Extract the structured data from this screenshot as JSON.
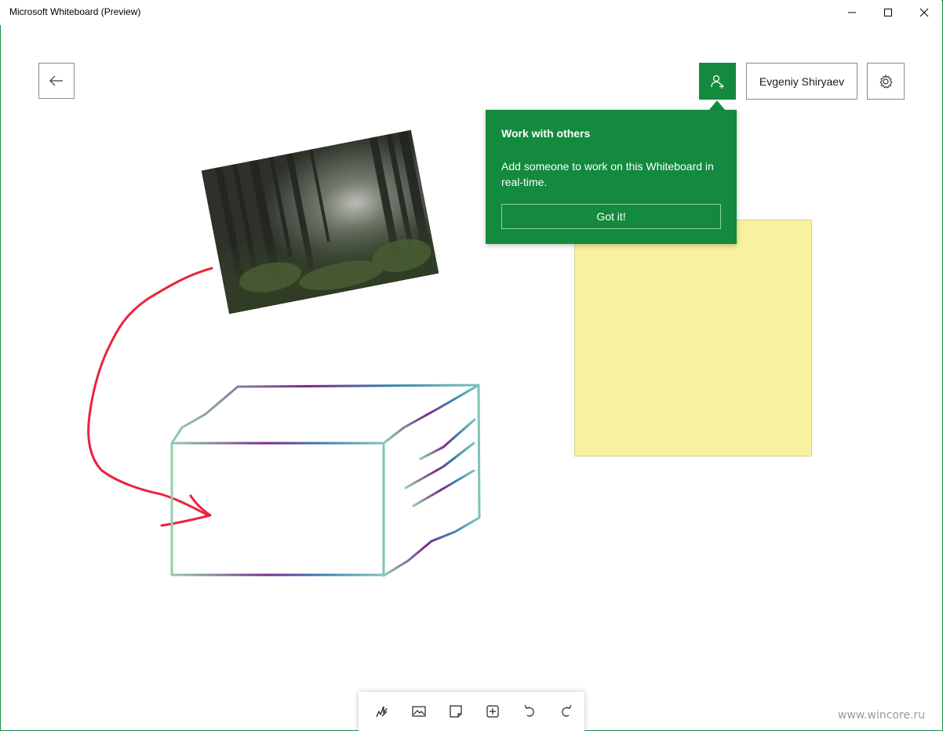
{
  "window": {
    "title": "Microsoft Whiteboard (Preview)"
  },
  "header": {
    "user_name": "Evgeniy Shiryaev"
  },
  "callout": {
    "title": "Work with others",
    "body": "Add someone to work on this Whiteboard in real-time.",
    "button_label": "Got it!"
  },
  "toolbar": {
    "tools": [
      "pen-icon",
      "image-icon",
      "sticky-note-icon",
      "insert-icon",
      "undo-icon",
      "redo-icon"
    ]
  },
  "canvas": {
    "sticky_note_color": "#f8f29f",
    "ink_color_red": "#e8243c"
  },
  "watermark": "www.wincore.ru",
  "colors": {
    "accent": "#138a3e",
    "window_border": "#1f8f47"
  }
}
